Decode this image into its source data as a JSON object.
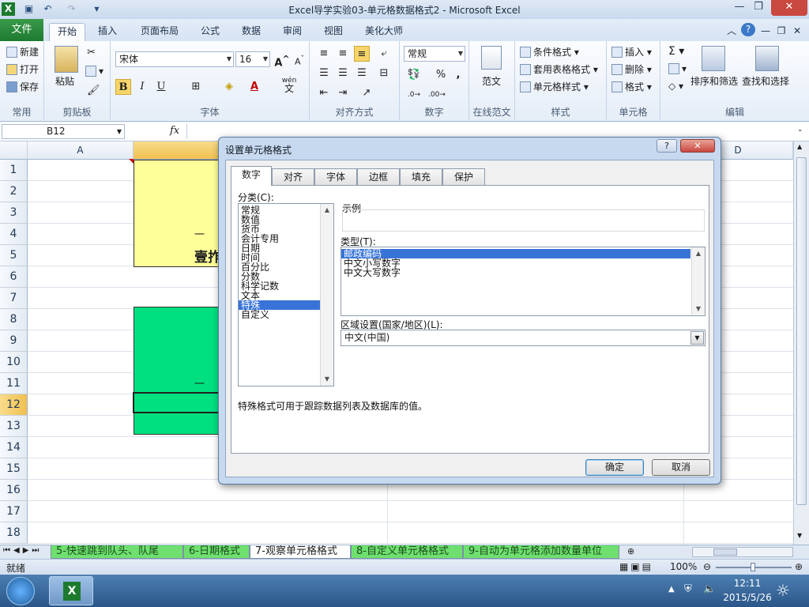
{
  "app": {
    "title": "Excel导学实验03-单元格数据格式2 - Microsoft Excel",
    "qat": {
      "save_icon": "save-icon",
      "undo_icon": "undo-icon",
      "redo_icon": "redo-icon"
    }
  },
  "window_controls": {
    "minimize": "—",
    "restore": "❐",
    "close": "✕"
  },
  "ribbon_tabs": [
    "文件",
    "开始",
    "插入",
    "页面布局",
    "公式",
    "数据",
    "审阅",
    "视图",
    "美化大师"
  ],
  "ribbon": {
    "common": {
      "new": "新建",
      "open": "打开",
      "save": "保存",
      "label": "常用"
    },
    "clipboard": {
      "paste": "粘贴",
      "label": "剪贴板"
    },
    "font": {
      "name": "宋体",
      "size": "16",
      "bold": "B",
      "italic": "I",
      "underline": "U",
      "label": "字体",
      "wen": "wén",
      "wen2": "文"
    },
    "align": {
      "label": "对齐方式"
    },
    "number": {
      "format": "常规",
      "percent": "%",
      "comma": ",",
      "label": "数字"
    },
    "online": {
      "fanwen": "范文",
      "label": "在线范文"
    },
    "styles": {
      "cond": "条件格式",
      "table": "套用表格格式",
      "cell": "单元格样式",
      "label": "样式"
    },
    "cells": {
      "insert": "插入",
      "delete": "删除",
      "format": "格式",
      "label": "单元格"
    },
    "edit": {
      "sort": "排序和筛选",
      "find": "查找和选择",
      "label": "编辑",
      "sigma": "Σ"
    }
  },
  "formula_bar": {
    "name_box": "B12",
    "fx": "fx",
    "value": ""
  },
  "grid": {
    "columns": [
      "A",
      "D"
    ],
    "rows": [
      "1",
      "2",
      "3",
      "4",
      "5",
      "6",
      "7",
      "8",
      "9",
      "10",
      "11",
      "12",
      "13",
      "14",
      "15",
      "16",
      "17",
      "18"
    ],
    "cell_fragments": {
      "r4": "一",
      "r5": "壹拃",
      "r11": "一"
    }
  },
  "sheet_tabs": [
    "5-快速跳到队头、队尾",
    "6-日期格式",
    "7-观察单元格格式",
    "8-自定义单元格格式",
    "9-自动为单元格添加数量单位"
  ],
  "status": {
    "ready": "就绪",
    "zoom": "100%"
  },
  "taskbar": {
    "time": "12:11",
    "date": "2015/5/26"
  },
  "dialog": {
    "title": "设置单元格格式",
    "tabs": [
      "数字",
      "对齐",
      "字体",
      "边框",
      "填充",
      "保护"
    ],
    "category_label": "分类(C):",
    "categories": [
      "常规",
      "数值",
      "货币",
      "会计专用",
      "日期",
      "时间",
      "百分比",
      "分数",
      "科学记数",
      "文本",
      "特殊",
      "自定义"
    ],
    "selected_category": "特殊",
    "sample_label": "示例",
    "type_label": "类型(T):",
    "types": [
      "邮政编码",
      "中文小写数字",
      "中文大写数字"
    ],
    "selected_type": "邮政编码",
    "locale_label": "区域设置(国家/地区)(L):",
    "locale_value": "中文(中国)",
    "description": "特殊格式可用于跟踪数据列表及数据库的值。",
    "ok": "确定",
    "cancel": "取消",
    "help": "?",
    "close": "✕"
  },
  "colors": {
    "yellow_fill": "#ffff99",
    "green_fill": "#00e080",
    "sheet_tab_green": "#6fe06f",
    "file_tab": "#1d7a2f",
    "selection": "#3874d8"
  }
}
